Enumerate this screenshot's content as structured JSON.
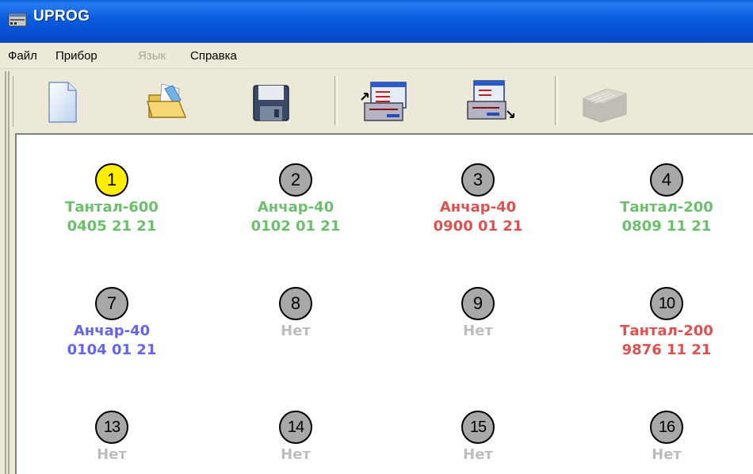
{
  "window": {
    "title": "UPROG"
  },
  "menu": [
    {
      "label": "Файл",
      "enabled": true
    },
    {
      "label": "Прибор",
      "enabled": true
    },
    {
      "label": "Язык",
      "enabled": false
    },
    {
      "label": "Справка",
      "enabled": true
    }
  ],
  "toolbar": [
    {
      "icon": "new-document-icon",
      "enabled": true
    },
    {
      "icon": "open-folder-icon",
      "enabled": true
    },
    {
      "icon": "save-disk-icon",
      "enabled": true
    },
    {
      "icon": "read-device-icon",
      "enabled": true
    },
    {
      "icon": "write-device-icon",
      "enabled": true
    },
    {
      "icon": "device-icon",
      "enabled": false
    }
  ],
  "colors": {
    "green": "#6cbf6c",
    "red": "#e05050",
    "blue": "#6464f0",
    "grey": "#bdbdbd",
    "active_badge": "#ffee00",
    "inactive_badge": "#a8a8a8"
  },
  "slots": [
    {
      "num": "1",
      "name": "Тантал-600",
      "serial": "0405 21 21",
      "color": "green",
      "active": true
    },
    {
      "num": "2",
      "name": "Анчар-40",
      "serial": "0102 01 21",
      "color": "green"
    },
    {
      "num": "3",
      "name": "Анчар-40",
      "serial": "0900 01 21",
      "color": "red"
    },
    {
      "num": "4",
      "name": "Тантал-200",
      "serial": "0809 11 21",
      "color": "green"
    },
    {
      "num": "7",
      "name": "Анчар-40",
      "serial": "0104 01 21",
      "color": "blue"
    },
    {
      "num": "8",
      "name": "Нет",
      "serial": "",
      "color": "grey"
    },
    {
      "num": "9",
      "name": "Нет",
      "serial": "",
      "color": "grey"
    },
    {
      "num": "10",
      "name": "Тантал-200",
      "serial": "9876 11 21",
      "color": "red"
    },
    {
      "num": "13",
      "name": "Нет",
      "serial": "",
      "color": "grey"
    },
    {
      "num": "14",
      "name": "Нет",
      "serial": "",
      "color": "grey"
    },
    {
      "num": "15",
      "name": "Нет",
      "serial": "",
      "color": "grey"
    },
    {
      "num": "16",
      "name": "Нет",
      "serial": "",
      "color": "grey"
    }
  ]
}
